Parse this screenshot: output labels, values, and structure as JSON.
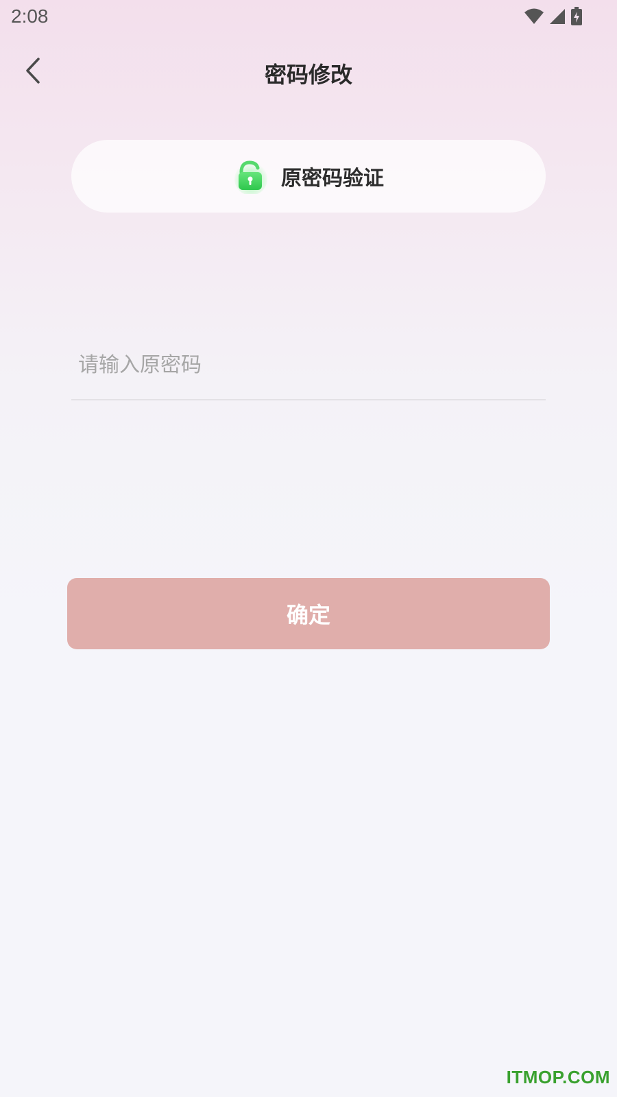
{
  "status_bar": {
    "time": "2:08",
    "icons": [
      "wifi-icon",
      "cell-signal-icon",
      "battery-charging-icon"
    ]
  },
  "header": {
    "title": "密码修改",
    "back_icon": "chevron-left-icon"
  },
  "step": {
    "icon": "lock-icon",
    "label": "原密码验证"
  },
  "form": {
    "password_placeholder": "请输入原密码",
    "password_value": ""
  },
  "actions": {
    "confirm_label": "确定"
  },
  "watermark": "ITMOP.COM",
  "colors": {
    "accent_button": "#e0aeab",
    "lock_green": "#3ed45c",
    "watermark_green": "#3aa12f"
  }
}
